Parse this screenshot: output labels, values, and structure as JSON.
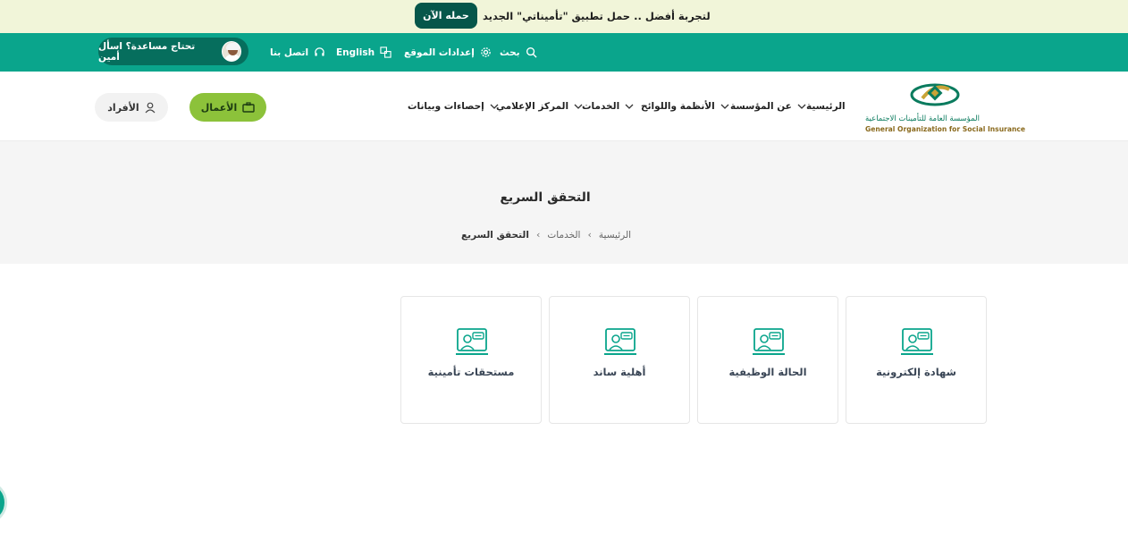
{
  "promo": {
    "text": "لتجربة أفضل .. حمل تطبيق \"تأميناتي\" الجديد",
    "button": "حمله الآن"
  },
  "topbar": {
    "search": "بحث",
    "settings": "إعدادات الموقع",
    "language": "English",
    "contact": "اتصل بنا",
    "help": "تحتاج مساعدة؟ اسأل أمين"
  },
  "logo": {
    "arabic": "المؤسسة العامة للتأمينات الاجتماعية",
    "english": "General Organization for Social Insurance"
  },
  "nav": {
    "home": "الرئيسية",
    "about": "عن المؤسسة",
    "regulations": "الأنظمة واللوائح",
    "services": "الخدمات",
    "media": "المركز الإعلامي",
    "stats": "إحصاءات وبيانات"
  },
  "buttons": {
    "business": "الأعمال",
    "individuals": "الأفراد"
  },
  "page": {
    "title": "التحقق السريع",
    "breadcrumb": [
      "الرئيسية",
      "الخدمات",
      "التحقق السريع"
    ]
  },
  "cards": [
    {
      "label": "شهادة إلكترونية",
      "icon": "support-agent-icon"
    },
    {
      "label": "الحالة الوظيفية",
      "icon": "support-agent-icon"
    },
    {
      "label": "أهلية ساند",
      "icon": "support-agent-icon"
    },
    {
      "label": "مستحقات تأمينية",
      "icon": "support-agent-icon"
    }
  ],
  "colors": {
    "primary": "#0aa58c",
    "dark": "#06564a",
    "accent": "#8cc23a",
    "promo_bg": "#f1f5d9"
  }
}
